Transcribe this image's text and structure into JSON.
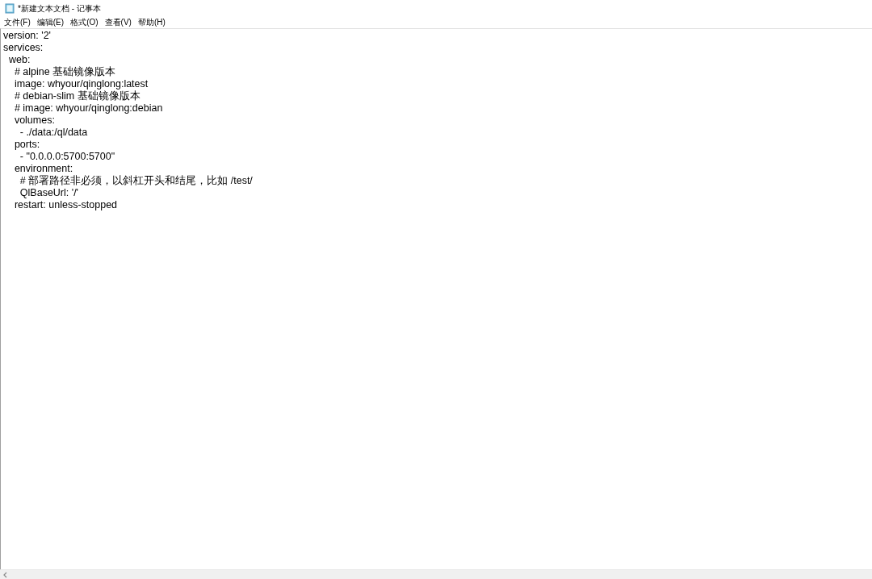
{
  "window": {
    "title": "*新建文本文档 - 记事本"
  },
  "menu": [
    "文件(F)",
    "编辑(E)",
    "格式(O)",
    "查看(V)",
    "帮助(H)"
  ],
  "editor": {
    "lines": [
      "version: '2'",
      "services:",
      "  web:",
      "    # alpine 基础镜像版本",
      "    image: whyour/qinglong:latest",
      "    # debian-slim 基础镜像版本",
      "    # image: whyour/qinglong:debian",
      "    volumes:",
      "      - ./data:/ql/data",
      "    ports:",
      "      - \"0.0.0.0:5700:5700\"",
      "    environment:",
      "      # 部署路径非必须，以斜杠开头和结尾，比如 /test/",
      "      QlBaseUrl: '/'",
      "    restart: unless-stopped"
    ]
  }
}
